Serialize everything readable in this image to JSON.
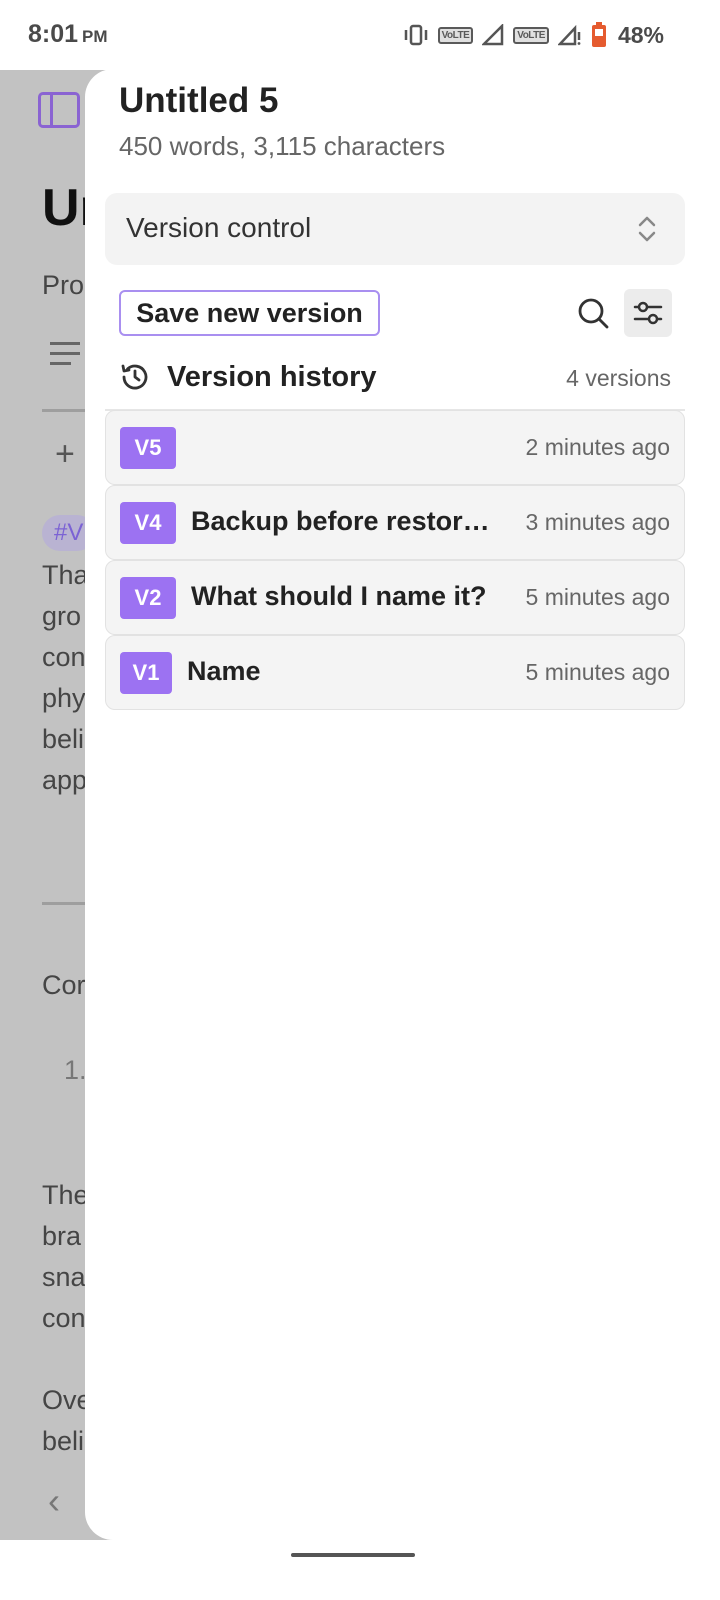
{
  "status_bar": {
    "time": "8:01",
    "ampm": "PM",
    "volte1": "VoLTE",
    "volte2": "VoLTE",
    "battery": "48%"
  },
  "background_doc": {
    "title_fragment": "Ur",
    "line_pro": "Pro",
    "tag_fragment": "#V",
    "para1": [
      "Tha",
      "gro",
      "con",
      "phy",
      "beli",
      "app"
    ],
    "line_con": "Cor",
    "list_num": "1.",
    "para2": [
      "The",
      "bra",
      "sna",
      "con"
    ],
    "para3": [
      "Ove",
      "beli"
    ]
  },
  "panel": {
    "doc_title": "Untitled 5",
    "doc_stats": "450 words, 3,115 characters",
    "mode_select": "Version control",
    "save_button": "Save new version",
    "history_title": "Version history",
    "history_count": "4 versions",
    "versions": [
      {
        "badge": "V5",
        "name": "",
        "time": "2 minutes ago"
      },
      {
        "badge": "V4",
        "name": "Backup before restoring",
        "time": "3 minutes ago"
      },
      {
        "badge": "V2",
        "name": "What should I name it?",
        "time": "5 minutes ago"
      },
      {
        "badge": "V1",
        "name": "Name",
        "time": "5 minutes ago"
      }
    ]
  },
  "colors": {
    "accent": "#9c72f2",
    "accent_border": "#a98ff0",
    "scrim": "#c2c2c2"
  }
}
